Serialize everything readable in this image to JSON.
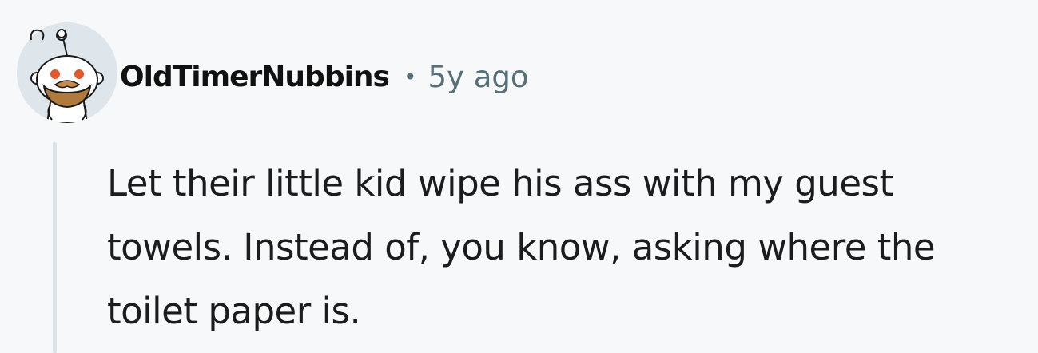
{
  "comment": {
    "author": "OldTimerNubbins",
    "separator": "•",
    "timestamp": "5y ago",
    "body": "Let their little kid wipe his ass with my guest towels. Instead of, you know, asking where the toilet paper is."
  },
  "colors": {
    "background": "#f6f8fa",
    "author_text": "#111111",
    "meta_text": "#576f76",
    "thread_line": "#dbe3e7"
  },
  "icons": {
    "avatar": "reddit-snoo-avatar-icon"
  }
}
